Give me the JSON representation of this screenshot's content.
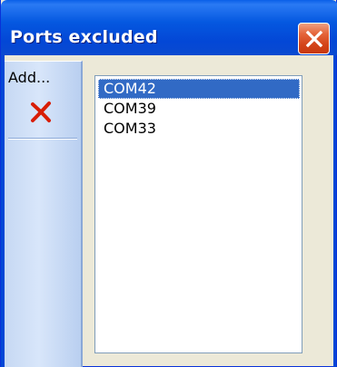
{
  "window": {
    "title": "Ports excluded"
  },
  "toolbar": {
    "add_label": "Add...",
    "remove_icon": "red-x-icon"
  },
  "ports_list": {
    "items": [
      "COM42",
      "COM39",
      "COM33"
    ],
    "selected_index": 0
  },
  "colors": {
    "titlebar": "#0558e0",
    "selection": "#316ac5",
    "remove_icon": "#d81e05",
    "close_button": "#d4451a"
  }
}
